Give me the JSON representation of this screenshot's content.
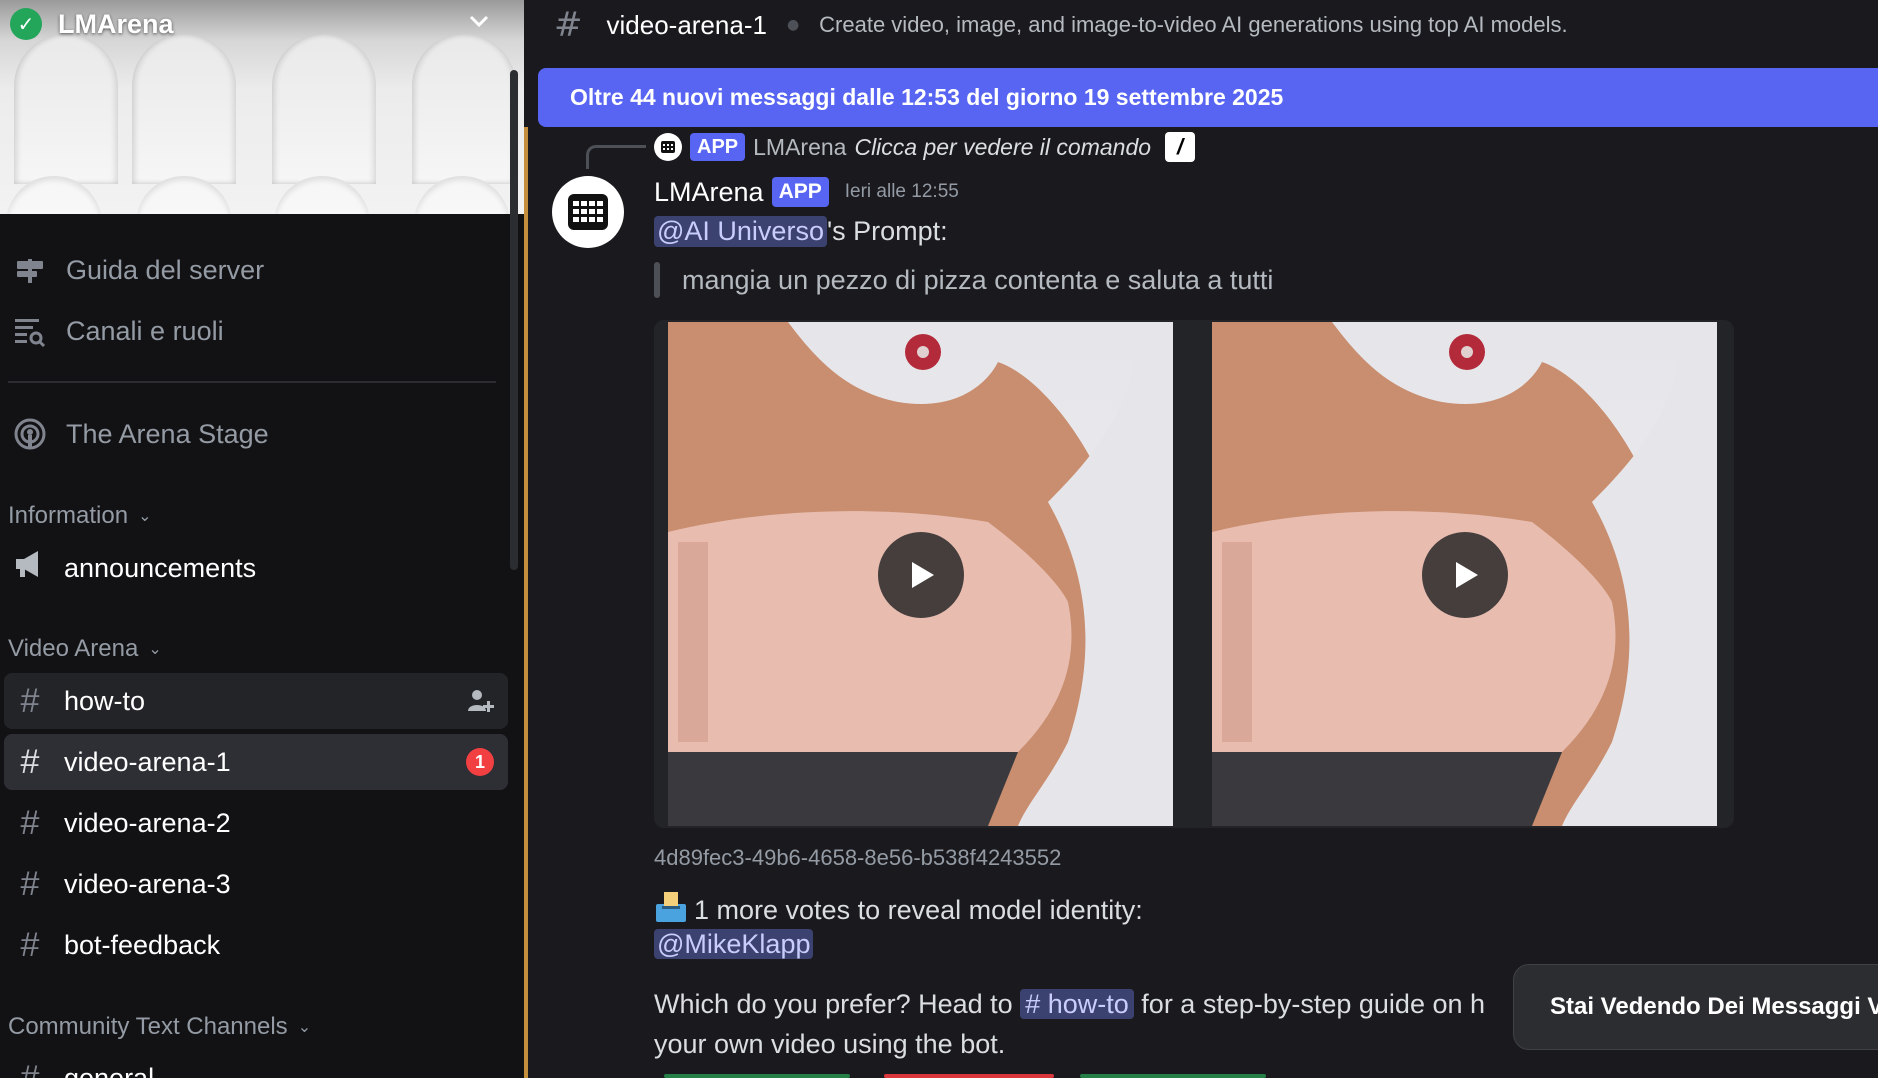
{
  "server": {
    "name": "LMArena"
  },
  "sidebar": {
    "top_items": [
      {
        "label": "Guida del server",
        "icon": "signpost-icon"
      },
      {
        "label": "Canali e ruoli",
        "icon": "channels-browse-icon"
      }
    ],
    "stage": {
      "label": "The Arena Stage",
      "icon": "stage-icon"
    },
    "categories": {
      "information": "Information",
      "video_arena": "Video Arena",
      "community": "Community Text Channels"
    },
    "channels": {
      "announcements": "announcements",
      "how_to": "how-to",
      "video_arena_1": "video-arena-1",
      "video_arena_2": "video-arena-2",
      "video_arena_3": "video-arena-3",
      "bot_feedback": "bot-feedback",
      "general": "general"
    },
    "unread_badge": "1"
  },
  "header": {
    "channel": "video-arena-1",
    "topic": "Create video, image, and image-to-video AI generations using top AI models."
  },
  "banner": {
    "new_messages": "Oltre 44 nuovi messaggi dalle 12:53 del giorno 19 settembre 2025"
  },
  "reply": {
    "tag": "APP",
    "name": "LMArena",
    "text": "Clicca per vedere il comando"
  },
  "message": {
    "author": "LMArena",
    "tag": "APP",
    "timestamp": "Ieri alle 12:55",
    "prompt_mention": "@AI Universo",
    "prompt_suffix": "'s Prompt:",
    "quote": "mangia un pezzo di pizza contenta e saluta a tutti",
    "id": "4d89fec3-49b6-4658-8e56-b538f4243552",
    "votes_text": "1 more votes to reveal model identity:",
    "votes_mention": "@MikeKlapp",
    "prefer_before": "Which do you prefer? Head to",
    "prefer_channel": "# how-to",
    "prefer_after": "for a step-by-step guide on h",
    "prefer_line2": "your own video using the bot."
  },
  "toast": {
    "text": "Stai Vedendo Dei Messaggi Ve"
  },
  "colors": {
    "blurple": "#5865f2",
    "unread": "#f23f42",
    "mention_bar": "#c38f3c"
  }
}
